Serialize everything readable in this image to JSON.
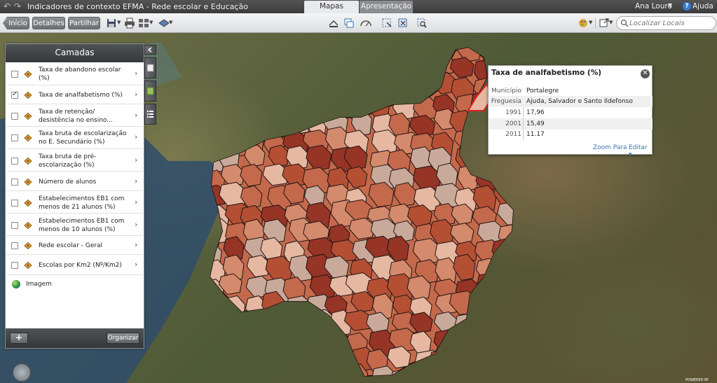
{
  "app": {
    "title": "Indicadores de contexto EFMA - Rede escolar e Educação",
    "tabs": [
      {
        "label": "Mapas",
        "active": true
      },
      {
        "label": "Apresentação",
        "active": false
      }
    ],
    "user": "Ana Louro",
    "help_label": "Ajuda"
  },
  "toolbar": {
    "nav": [
      "Início",
      "Detalhes",
      "Partilhar"
    ],
    "search_placeholder": "Localizar Locais",
    "icons": [
      "save-icon",
      "print-icon",
      "basemap-icon",
      "layer-style-icon",
      "measure-icon",
      "overlay-icon",
      "gauge-icon",
      "select-icon",
      "identify-icon",
      "zoom-select-icon",
      "theme-icon",
      "export-icon"
    ]
  },
  "layers": {
    "header": "Camadas",
    "items": [
      {
        "label": "Taxa de abandono escolar (%)",
        "checked": false
      },
      {
        "label": "Taxa de analfabetismo (%)",
        "checked": true
      },
      {
        "label": "Taxa de retenção/ desistência no ensino...",
        "checked": false
      },
      {
        "label": "Taxa bruta de escolarização no E. Secundário (%)",
        "checked": false
      },
      {
        "label": "Taxa bruta de pré-escolarização (%)",
        "checked": false
      },
      {
        "label": "Número de alunos",
        "checked": false
      },
      {
        "label": "Estabelecimentos EB1 com menos de 21 alunos (%)",
        "checked": false
      },
      {
        "label": "Estabelecimentos EB1 com menos de 10 alunos (%)",
        "checked": false
      },
      {
        "label": "Rede escolar - Geral",
        "checked": false
      },
      {
        "label": "Escolas por Km2 (Nº/Km2)",
        "checked": false
      }
    ],
    "basemap_label": "Imagem",
    "add_label": "+",
    "organize_label": "Organizar"
  },
  "popup": {
    "title": "Taxa de analfabetismo (%)",
    "rows": [
      {
        "key": "Município",
        "value": "Portalegre"
      },
      {
        "key": "Freguesia",
        "value": "Ajuda, Salvador e Santo Ildefonso"
      },
      {
        "key": "1991",
        "value": "17,96"
      },
      {
        "key": "2001",
        "value": "15,49"
      },
      {
        "key": "2011",
        "value": "11.17"
      }
    ],
    "zoom_label": "Zoom Para",
    "edit_label": "Editar"
  },
  "colors": {
    "choropleth": [
      "#e6b8a2",
      "#d48a6c",
      "#c4694b",
      "#b44f34",
      "#963426",
      "#c9a99a"
    ],
    "highlight": "#e0201c"
  },
  "footer": {
    "powered": "POWERED BY"
  }
}
